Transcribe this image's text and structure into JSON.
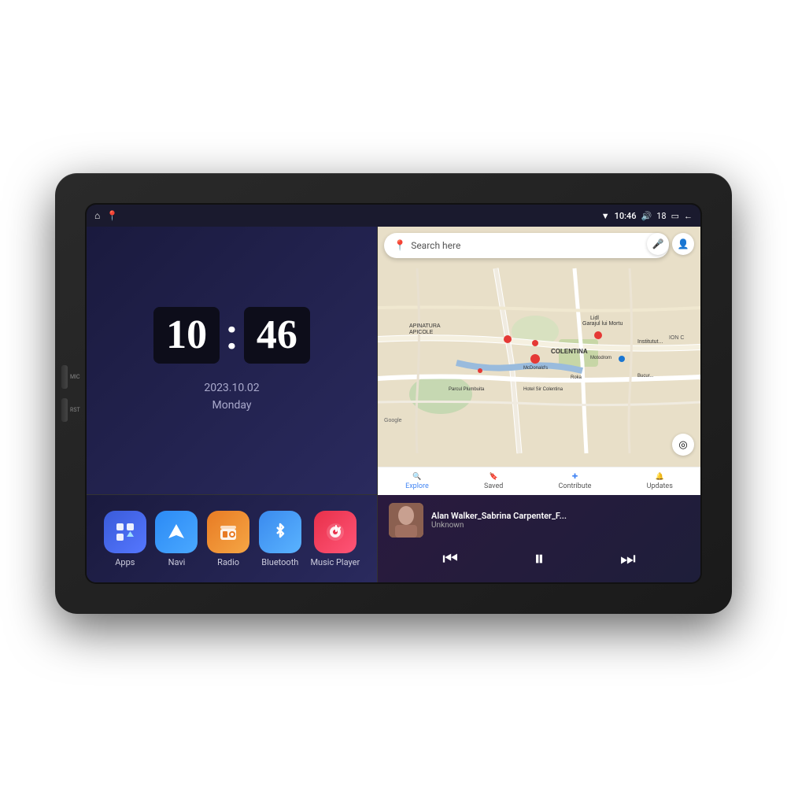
{
  "device": {
    "outer_bg": "#1a1a1a"
  },
  "status_bar": {
    "left_icons": [
      "home",
      "map-pin"
    ],
    "time": "10:46",
    "volume_icon": "🔊",
    "volume_level": "18",
    "window_icon": "▭",
    "back_icon": "←",
    "wifi_icon": "▼"
  },
  "clock": {
    "hour": "10",
    "minute": "46",
    "date": "2023.10.02",
    "day": "Monday"
  },
  "map": {
    "search_placeholder": "Search here",
    "place_labels": [
      "APINATURA APICOLE",
      "Garajul lui Mortu",
      "COLENTINA",
      "McDonald's",
      "Parcul Plumbuita",
      "Hotel Sir Colentina",
      "Lidl",
      "Roka",
      "Motodrom"
    ],
    "bottom_items": [
      {
        "icon": "🔍",
        "label": "Explore"
      },
      {
        "icon": "🔖",
        "label": "Saved"
      },
      {
        "icon": "✚",
        "label": "Contribute"
      },
      {
        "icon": "⬆",
        "label": "Updates"
      }
    ]
  },
  "apps": [
    {
      "id": "apps",
      "label": "Apps",
      "icon": "⊞",
      "color_class": "apps-icon"
    },
    {
      "id": "navi",
      "label": "Navi",
      "icon": "▲",
      "color_class": "navi-icon"
    },
    {
      "id": "radio",
      "label": "Radio",
      "icon": "📻",
      "color_class": "radio-icon"
    },
    {
      "id": "bluetooth",
      "label": "Bluetooth",
      "icon": "◈",
      "color_class": "bt-icon"
    },
    {
      "id": "music",
      "label": "Music Player",
      "icon": "♫",
      "color_class": "music-icon"
    }
  ],
  "music": {
    "title": "Alan Walker_Sabrina Carpenter_F...",
    "artist": "Unknown",
    "prev_icon": "⏮",
    "play_icon": "⏸",
    "next_icon": "⏭"
  }
}
